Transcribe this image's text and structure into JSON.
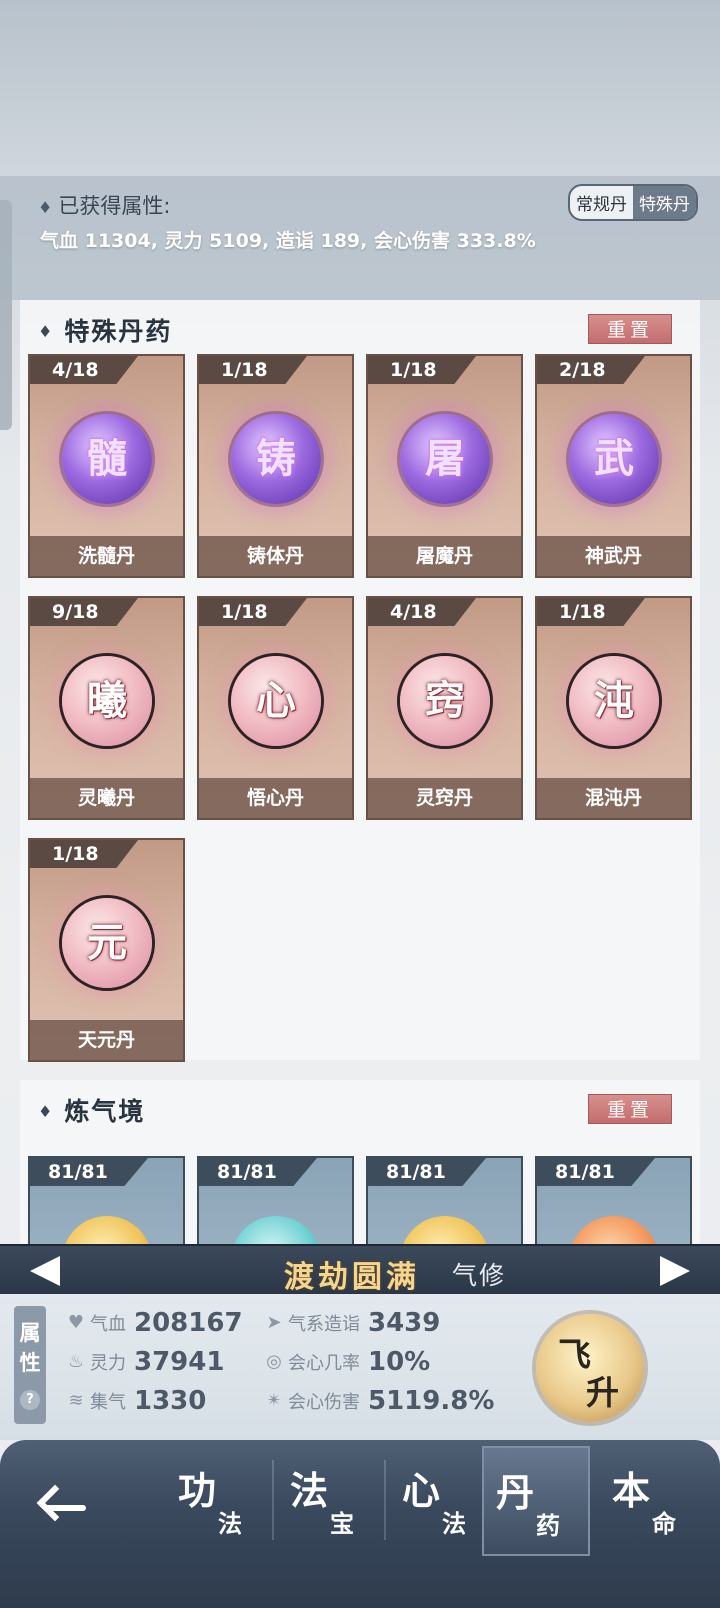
{
  "acquired": {
    "title": "已获得属性:",
    "values": "气血 11304, 灵力 5109, 造诣 189, 会心伤害 333.8%",
    "toggle": [
      "常规丹",
      "特殊丹"
    ]
  },
  "special_section": {
    "title": "特殊丹药",
    "reset_label": "重置",
    "pills": [
      {
        "count": "4/18",
        "glyph": "髓",
        "name": "洗髓丹",
        "style": "purple"
      },
      {
        "count": "1/18",
        "glyph": "铸",
        "name": "铸体丹",
        "style": "purple"
      },
      {
        "count": "1/18",
        "glyph": "屠",
        "name": "屠魔丹",
        "style": "purple"
      },
      {
        "count": "2/18",
        "glyph": "武",
        "name": "神武丹",
        "style": "purple"
      },
      {
        "count": "9/18",
        "glyph": "曦",
        "name": "灵曦丹",
        "style": "pink"
      },
      {
        "count": "1/18",
        "glyph": "心",
        "name": "悟心丹",
        "style": "pink"
      },
      {
        "count": "4/18",
        "glyph": "窍",
        "name": "灵窍丹",
        "style": "pink"
      },
      {
        "count": "1/18",
        "glyph": "沌",
        "name": "混沌丹",
        "style": "pink"
      },
      {
        "count": "1/18",
        "glyph": "元",
        "name": "天元丹",
        "style": "pink"
      }
    ]
  },
  "qi_section": {
    "title": "炼气境",
    "reset_label": "重置",
    "pills": [
      {
        "count": "81/81",
        "style": "gold"
      },
      {
        "count": "81/81",
        "style": "teal"
      },
      {
        "count": "81/81",
        "style": "gold"
      },
      {
        "count": "81/81",
        "style": "orange"
      }
    ]
  },
  "realm": {
    "name": "渡劫圆满",
    "type": "气修"
  },
  "stats": {
    "tab_label": "属性",
    "help": "?",
    "qixue": {
      "label": "气血",
      "value": "208167"
    },
    "lingli": {
      "label": "灵力",
      "value": "37941"
    },
    "jiqi": {
      "label": "集气",
      "value": "1330"
    },
    "zaoyi": {
      "label": "气系造诣",
      "value": "3439"
    },
    "crit_rate": {
      "label": "会心几率",
      "value": "10%"
    },
    "crit_dmg": {
      "label": "会心伤害",
      "value": "5119.8%"
    },
    "ascend_label": [
      "飞",
      "升"
    ]
  },
  "nav": [
    {
      "big": "功",
      "small": "法"
    },
    {
      "big": "法",
      "small": "宝"
    },
    {
      "big": "心",
      "small": "法"
    },
    {
      "big": "丹",
      "small": "药",
      "active": true
    },
    {
      "big": "本",
      "small": "命"
    }
  ],
  "colors": {
    "reset": "#c26d6d",
    "realm_gold": "#f4d591",
    "card_border": "#6a5148"
  }
}
